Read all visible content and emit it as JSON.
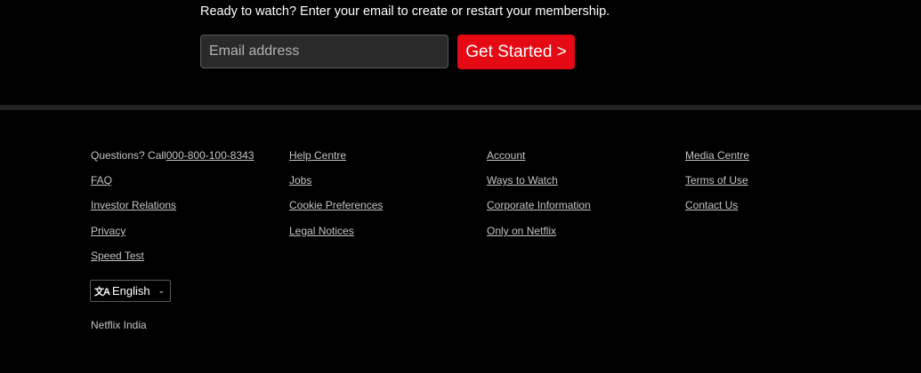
{
  "signup": {
    "prompt": "Ready to watch? Enter your email to create or restart your membership.",
    "email_placeholder": "Email address",
    "button_label": "Get Started >"
  },
  "footer": {
    "question_text": "Questions? Call",
    "phone": "000-800-100-8343",
    "columns": [
      [
        "FAQ",
        "Investor Relations",
        "Privacy",
        "Speed Test"
      ],
      [
        "Help Centre",
        "Jobs",
        "Cookie Preferences",
        "Legal Notices"
      ],
      [
        "Account",
        "Ways to Watch",
        "Corporate Information",
        "Only on Netflix"
      ],
      [
        "Media Centre",
        "Terms of Use",
        "Contact Us"
      ]
    ],
    "language": {
      "icon": "translate-icon",
      "selected": "English"
    },
    "country": "Netflix India"
  },
  "colors": {
    "accent": "#e50914",
    "background": "#000000",
    "divider": "#232323"
  }
}
